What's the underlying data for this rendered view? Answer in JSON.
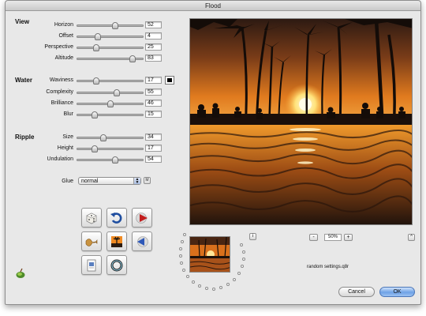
{
  "window": {
    "title": "Flood"
  },
  "view": {
    "section": "View",
    "rows": [
      {
        "label": "Horizon",
        "value": "52"
      },
      {
        "label": "Offset",
        "value": "4"
      },
      {
        "label": "Perspective",
        "value": "25"
      },
      {
        "label": "Altitude",
        "value": "83"
      }
    ]
  },
  "water": {
    "section": "Water",
    "rows": [
      {
        "label": "Waviness",
        "value": "17"
      },
      {
        "label": "Complexity",
        "value": "55"
      },
      {
        "label": "Brilliance",
        "value": "46"
      },
      {
        "label": "Blur",
        "value": "15"
      }
    ],
    "color": "#000000"
  },
  "ripple": {
    "section": "Ripple",
    "rows": [
      {
        "label": "Size",
        "value": "34"
      },
      {
        "label": "Height",
        "value": "17"
      },
      {
        "label": "Undulation",
        "value": "54"
      }
    ]
  },
  "glue": {
    "label": "Glue",
    "value": "normal",
    "mode_button": "M"
  },
  "toolbar": {
    "buttons": [
      {
        "name": "random-dice-icon"
      },
      {
        "name": "undo-arrow-icon"
      },
      {
        "name": "play-forward-icon"
      },
      {
        "name": "wave-preset-icon"
      },
      {
        "name": "photo-palm-icon"
      },
      {
        "name": "play-back-icon"
      },
      {
        "name": "document-icon"
      },
      {
        "name": "ring-icon"
      }
    ]
  },
  "preview": {
    "info_button": "i",
    "zoom_out": "-",
    "zoom": "50%",
    "zoom_in": "+",
    "collapse_button": "^"
  },
  "settings": {
    "filename": "random settings.q8r"
  },
  "buttons": {
    "cancel": "Cancel",
    "ok": "OK"
  },
  "colors": {
    "accent": "#6ea2e6",
    "sunset_orange": "#e67a1c",
    "window_bg": "#e8e8e8"
  }
}
